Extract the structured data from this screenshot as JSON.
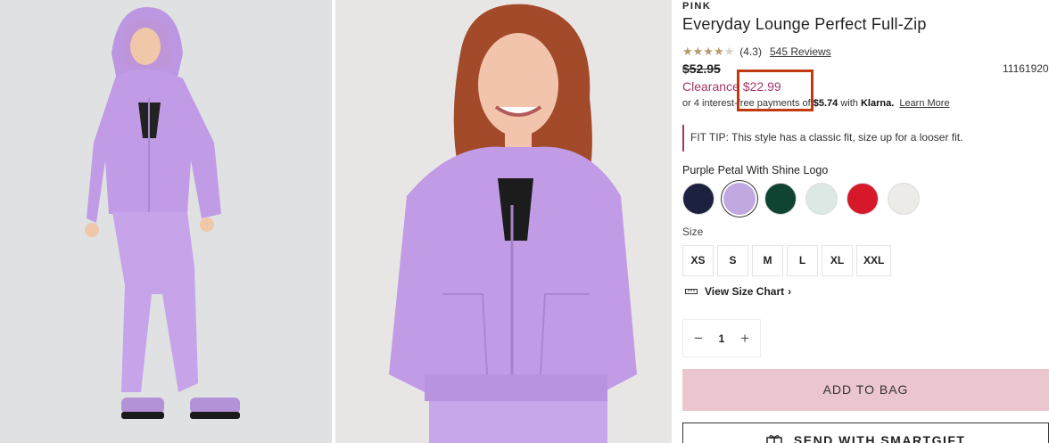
{
  "product": {
    "brand": "PINK",
    "title": "Everyday Lounge Perfect Full-Zip",
    "rating_value": "(4.3)",
    "rating_stars": 4.3,
    "reviews_label": "545 Reviews",
    "old_price": "$52.95",
    "sku": "11161920",
    "clearance_label": "Clearance",
    "sale_price": "$22.99",
    "klarna": {
      "prefix": "or 4 interest-free payments of",
      "amount": "$5.74",
      "with": "with",
      "brand": "Klarna.",
      "learn_more": "Learn More"
    },
    "fit_tip": "FIT TIP: This style has a classic fit, size up for a looser fit."
  },
  "color": {
    "selected_name": "Purple Petal With Shine Logo",
    "swatches": [
      {
        "name": "navy",
        "hex": "#1c2140"
      },
      {
        "name": "purple-petal",
        "hex": "#c2a8e0",
        "selected": true
      },
      {
        "name": "forest-green",
        "hex": "#0f4432"
      },
      {
        "name": "mint",
        "hex": "#dce8e4"
      },
      {
        "name": "red",
        "hex": "#d7172a"
      },
      {
        "name": "heather-white",
        "hex": "#ecebe8"
      }
    ]
  },
  "size": {
    "label": "Size",
    "options": [
      "XS",
      "S",
      "M",
      "L",
      "XL",
      "XXL"
    ],
    "chart_link": "View Size Chart"
  },
  "quantity": {
    "value": "1",
    "minus": "−",
    "plus": "+"
  },
  "actions": {
    "add_to_bag": "ADD TO BAG",
    "send_gift": "SEND WITH SMARTGIFT"
  },
  "colors": {
    "accent": "#a4376a",
    "highlight_box": "#c0390f",
    "add_to_bag_bg": "#ebc6cf",
    "hoodie": "#c19be6"
  }
}
